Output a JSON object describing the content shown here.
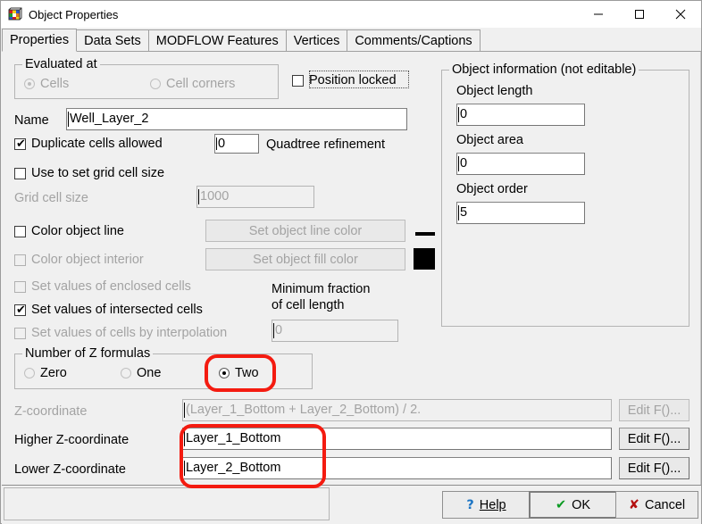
{
  "window": {
    "title": "Object Properties",
    "icon": "cube-icon",
    "controls": {
      "minimize": "minimize-icon",
      "maximize": "maximize-icon",
      "close": "close-icon"
    }
  },
  "tabs": [
    {
      "label": "Properties",
      "active": true
    },
    {
      "label": "Data Sets",
      "active": false
    },
    {
      "label": "MODFLOW Features",
      "active": false
    },
    {
      "label": "Vertices",
      "active": false
    },
    {
      "label": "Comments/Captions",
      "active": false
    }
  ],
  "properties": {
    "evaluated_at": {
      "title": "Evaluated at",
      "options": [
        {
          "label": "Cells",
          "checked": true,
          "disabled": true
        },
        {
          "label": "Cell corners",
          "checked": false,
          "disabled": true
        }
      ]
    },
    "position_locked": {
      "label": "Position locked",
      "checked": false
    },
    "name": {
      "label": "Name",
      "value": "Well_Layer_2"
    },
    "duplicate_cells": {
      "label": "Duplicate cells allowed",
      "checked": true
    },
    "quadtree": {
      "label": "Quadtree refinement",
      "value": "0"
    },
    "use_grid_cell_size": {
      "label": "Use to set grid cell size",
      "checked": false
    },
    "grid_cell_size": {
      "label": "Grid cell size",
      "value": "1000",
      "disabled": true
    },
    "color_object_line": {
      "label": "Color object line",
      "checked": false
    },
    "set_object_line_color": {
      "label": "Set object line color",
      "disabled": true
    },
    "line_color": "#000000",
    "color_object_interior": {
      "label": "Color object interior",
      "checked": false,
      "disabled": true
    },
    "set_object_fill_color": {
      "label": "Set object fill color",
      "disabled": true
    },
    "fill_color": "#000000",
    "set_values_enclosed": {
      "label": "Set values of enclosed cells",
      "checked": false,
      "disabled": true
    },
    "set_values_intersected": {
      "label": "Set values of intersected cells",
      "checked": true
    },
    "set_values_interpolation": {
      "label": "Set values of cells by interpolation",
      "checked": false,
      "disabled": true
    },
    "min_fraction": {
      "label_line1": "Minimum fraction",
      "label_line2": "of cell length",
      "value": "0",
      "disabled": true
    },
    "z_formulas": {
      "title": "Number of Z formulas",
      "options": [
        {
          "label": "Zero",
          "checked": false
        },
        {
          "label": "One",
          "checked": false
        },
        {
          "label": "Two",
          "checked": true,
          "highlighted": true
        }
      ]
    }
  },
  "object_info": {
    "title": "Object information (not editable)",
    "fields": [
      {
        "label": "Object length",
        "value": "0"
      },
      {
        "label": "Object area",
        "value": "0"
      },
      {
        "label": "Object order",
        "value": "5"
      }
    ]
  },
  "z_rows": [
    {
      "label": "Z-coordinate",
      "value": "(Layer_1_Bottom + Layer_2_Bottom) / 2.",
      "button": "Edit F()...",
      "disabled": true
    },
    {
      "label": "Higher Z-coordinate",
      "value": "Layer_1_Bottom",
      "button": "Edit F()...",
      "disabled": false
    },
    {
      "label": "Lower Z-coordinate",
      "value": "Layer_2_Bottom",
      "button": "Edit F()...",
      "disabled": false
    }
  ],
  "footer": {
    "help": {
      "label": "Help",
      "mnemonic": "H",
      "icon": "question-icon",
      "icon_color": "#1b74c4"
    },
    "ok": {
      "label": "OK",
      "icon": "check-icon",
      "icon_color": "#0a9a22"
    },
    "cancel": {
      "label": "Cancel",
      "icon": "x-icon",
      "icon_color": "#b40f0f"
    }
  },
  "annotations": {
    "highlight_color": "#f41b10",
    "boxes": [
      {
        "name": "two-radio-highlight"
      },
      {
        "name": "z-coordinate-fields-highlight"
      }
    ]
  }
}
